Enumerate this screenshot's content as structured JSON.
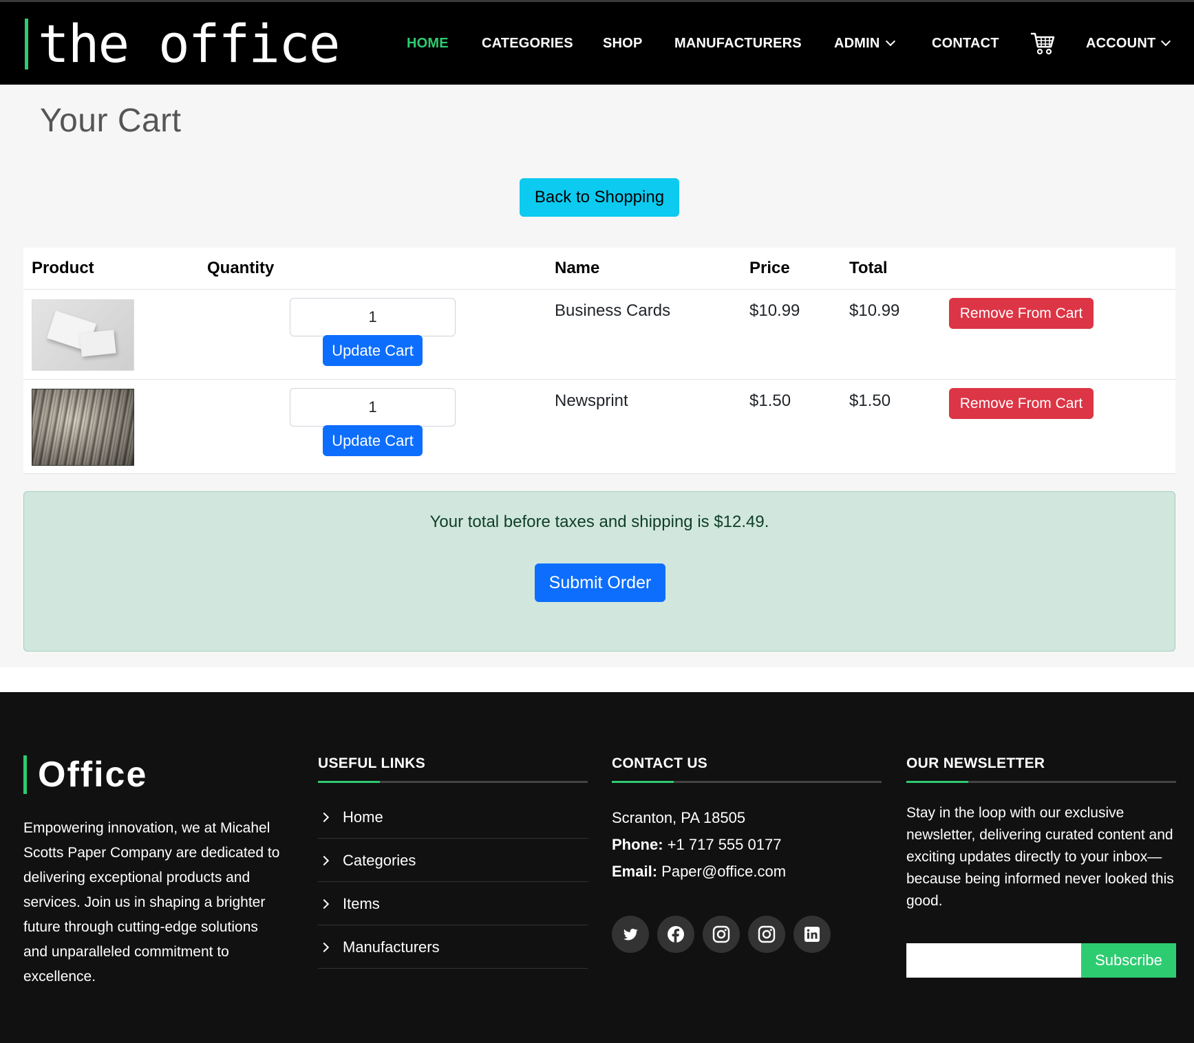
{
  "brand": {
    "logo_text": "the office",
    "accent_color": "#2ecc71"
  },
  "nav": {
    "home": "HOME",
    "categories": "CATEGORIES",
    "shop": "SHOP",
    "manufacturers": "MANUFACTURERS",
    "admin": "ADMIN",
    "contact": "CONTACT",
    "cart_icon": "shopping-cart-icon",
    "account": "ACCOUNT",
    "active": "HOME"
  },
  "page": {
    "title": "Your Cart",
    "back_button": "Back to Shopping"
  },
  "cart": {
    "headers": {
      "product": "Product",
      "quantity": "Quantity",
      "name": "Name",
      "price": "Price",
      "total": "Total"
    },
    "items": [
      {
        "image": "business-cards-image",
        "quantity": "1",
        "update_label": "Update Cart",
        "name": "Business Cards",
        "price": "$10.99",
        "total": "$10.99",
        "remove_label": "Remove From Cart"
      },
      {
        "image": "newsprint-image",
        "quantity": "1",
        "update_label": "Update Cart",
        "name": "Newsprint",
        "price": "$1.50",
        "total": "$1.50",
        "remove_label": "Remove From Cart"
      }
    ],
    "summary_text": "Your total before taxes and shipping is $12.49.",
    "submit_label": "Submit Order"
  },
  "footer": {
    "logo_text": "Office",
    "about": "Empowering innovation, we at Micahel Scotts Paper Company are dedicated to delivering exceptional products and services. Join us in shaping a brighter future through cutting-edge solutions and unparalleled commitment to excellence.",
    "useful_links": {
      "heading": "USEFUL LINKS",
      "items": [
        "Home",
        "Categories",
        "Items",
        "Manufacturers"
      ]
    },
    "contact": {
      "heading": "CONTACT US",
      "address": "Scranton, PA 18505",
      "phone_label": "Phone:",
      "phone": "+1 717 555 0177",
      "email_label": "Email:",
      "email": "Paper@office.com",
      "social_icons": [
        "twitter-icon",
        "facebook-icon",
        "instagram-icon",
        "instagram-icon",
        "linkedin-icon"
      ]
    },
    "newsletter": {
      "heading": "OUR NEWSLETTER",
      "text": "Stay in the loop with our exclusive newsletter, delivering curated content and exciting updates directly to your inbox—because being informed never looked this good.",
      "input_value": "",
      "button": "Subscribe"
    }
  }
}
